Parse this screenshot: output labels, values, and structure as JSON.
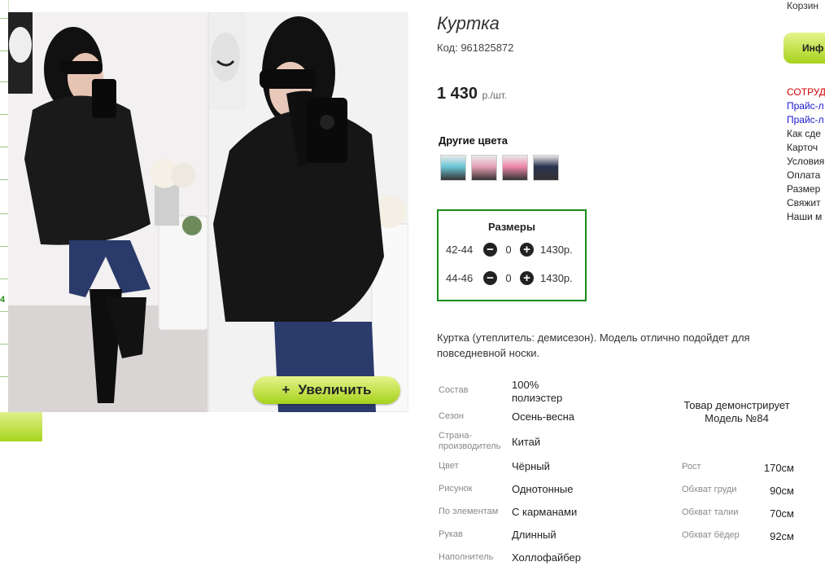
{
  "product": {
    "title": "Куртка",
    "code": "Код: 961825872",
    "price": "1 430",
    "price_unit": "р./шт."
  },
  "gallery": {
    "zoom_button": "Увеличить",
    "left_number": "4"
  },
  "colors": {
    "heading": "Другие цвета",
    "swatches": [
      "#6cc7d8",
      "#e8a0b6",
      "#ee88a8",
      "#2a3350"
    ]
  },
  "sizes": {
    "heading": "Размеры",
    "rows": [
      {
        "label": "42-44",
        "qty": "0",
        "price": "1430р."
      },
      {
        "label": "44-46",
        "qty": "0",
        "price": "1430р."
      }
    ]
  },
  "description": "Куртка (утеплитель: демисезон). Модель отлично подойдет для повседневной носки.",
  "properties": [
    {
      "key": "Состав",
      "value": "100% полиэстер"
    },
    {
      "key": "Сезон",
      "value": "Осень-весна"
    },
    {
      "key": "Страна-производитель",
      "value": "Китай"
    },
    {
      "key": "Цвет",
      "value": "Чёрный"
    },
    {
      "key": "Рисунок",
      "value": "Однотонные"
    },
    {
      "key": "По элементам",
      "value": "С карманами"
    },
    {
      "key": "Рукав",
      "value": "Длинный"
    },
    {
      "key": "Наполнитель",
      "value": "Холлофайбер"
    }
  ],
  "model": {
    "caption": "Товар демонстрирует Модель №84",
    "measurements": [
      {
        "key": "Рост",
        "value": "170см"
      },
      {
        "key": "Обхват груди",
        "value": "90см"
      },
      {
        "key": "Обхват талии",
        "value": "70см"
      },
      {
        "key": "Обхват бёдер",
        "value": "92см"
      }
    ]
  },
  "sidebar": {
    "cart": "Корзин",
    "info_button": "Инф",
    "links": [
      {
        "label": "СОТРУД",
        "color": "#d40000"
      },
      {
        "label": "Прайс-л",
        "color": "#1a1acc"
      },
      {
        "label": "Прайс-л",
        "color": "#1a1acc"
      },
      {
        "label": "Как сде",
        "color": "#222222"
      },
      {
        "label": "Карточ",
        "color": "#222222"
      },
      {
        "label": "Условия",
        "color": "#222222"
      },
      {
        "label": "Оплата",
        "color": "#222222"
      },
      {
        "label": "Размер",
        "color": "#222222"
      },
      {
        "label": "Свяжит",
        "color": "#222222"
      },
      {
        "label": "Наши м",
        "color": "#222222"
      }
    ]
  }
}
